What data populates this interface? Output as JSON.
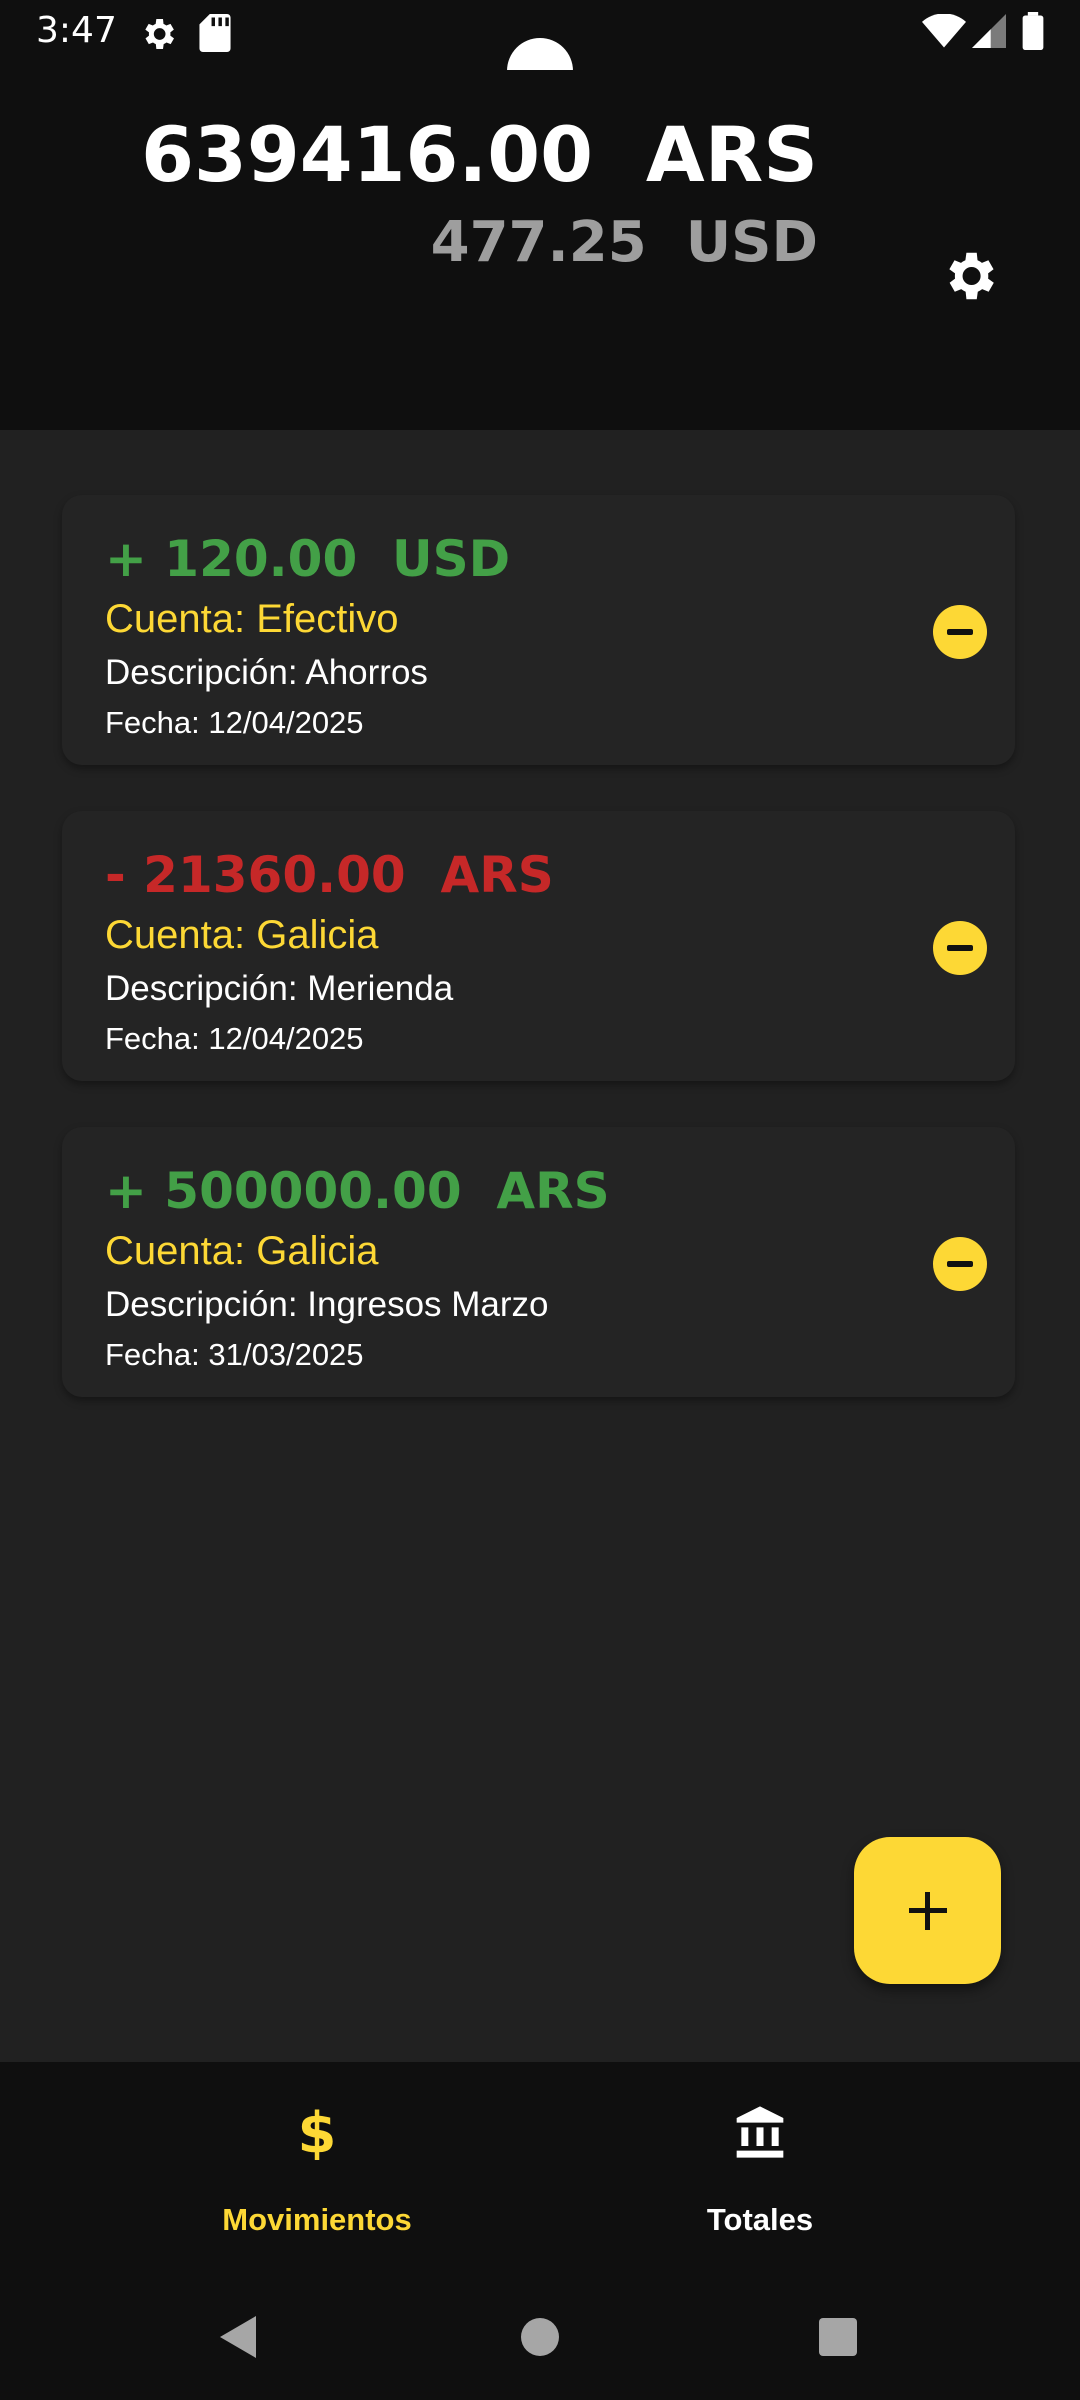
{
  "status_bar": {
    "time": "3:47"
  },
  "header": {
    "total_primary": "639416.00  ARS",
    "total_secondary": "477.25  USD",
    "settings_icon": "gear-icon"
  },
  "movements": [
    {
      "amount": "+ 120.00  USD",
      "sign": "positive",
      "account": "Cuenta: Efectivo",
      "description": "Descripción: Ahorros",
      "date": "Fecha: 12/04/2025"
    },
    {
      "amount": "- 21360.00  ARS",
      "sign": "negative",
      "account": "Cuenta: Galicia",
      "description": "Descripción: Merienda",
      "date": "Fecha: 12/04/2025"
    },
    {
      "amount": "+ 500000.00  ARS",
      "sign": "positive",
      "account": "Cuenta: Galicia",
      "description": "Descripción: Ingresos Marzo",
      "date": "Fecha: 31/03/2025"
    }
  ],
  "fab": {
    "icon": "plus-icon"
  },
  "bottom_nav": {
    "items": [
      {
        "label": "Movimientos",
        "icon": "dollar-icon",
        "active": true
      },
      {
        "label": "Totales",
        "icon": "bank-icon",
        "active": false
      }
    ]
  },
  "colors": {
    "accent": "#fdd835",
    "positive": "#43a047",
    "negative": "#c62828",
    "background": "#212121",
    "card": "#242424"
  }
}
